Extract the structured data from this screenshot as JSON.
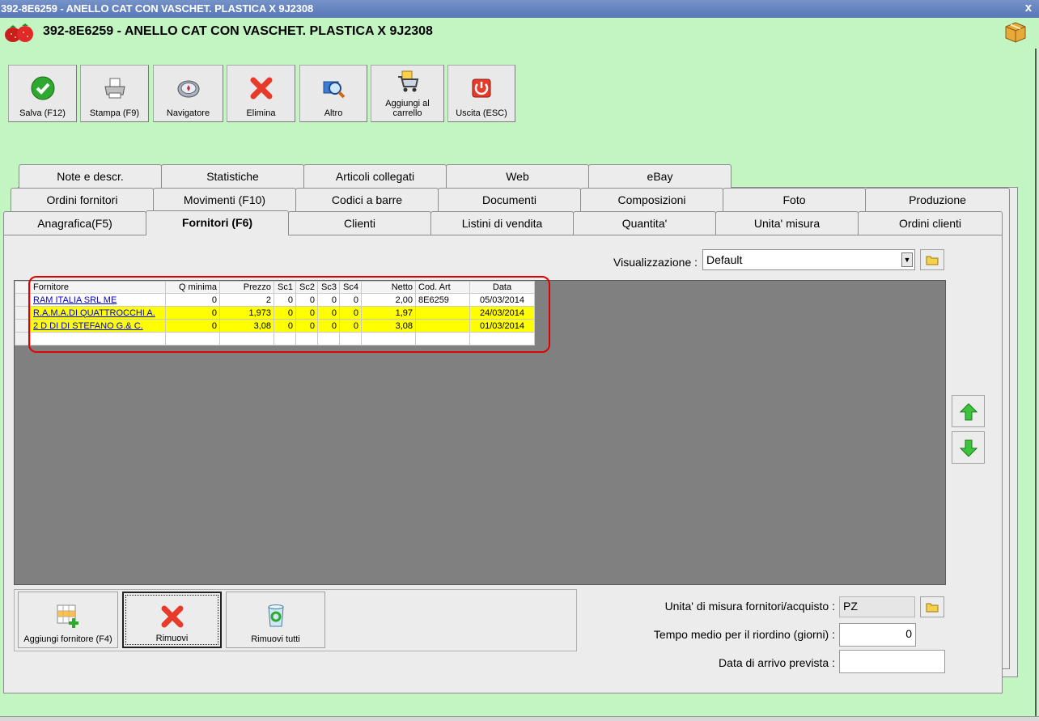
{
  "window": {
    "titlebar_text": "392-8E6259 - ANELLO CAT CON VASCHET. PLASTICA X 9J2308",
    "close_glyph": "x",
    "header_title": "392-8E6259 - ANELLO CAT CON VASCHET. PLASTICA X 9J2308",
    "accent_color": "#c2f5c2"
  },
  "toolbar": {
    "save": "Salva (F12)",
    "print": "Stampa (F9)",
    "navigator": "Navigatore",
    "delete": "Elimina",
    "other": "Altro",
    "add_to_cart_1": "Aggiungi al",
    "add_to_cart_2": "carrello",
    "exit": "Uscita (ESC)"
  },
  "tabs": {
    "row1": [
      "Note e descr.",
      "Statistiche",
      "Articoli collegati",
      "Web",
      "eBay"
    ],
    "row2": [
      "Ordini fornitori",
      "Movimenti (F10)",
      "Codici a barre",
      "Documenti",
      "Composizioni",
      "Foto",
      "Produzione"
    ],
    "row3": [
      "Anagrafica(F5)",
      "Fornitori (F6)",
      "Clienti",
      "Listini di vendita",
      "Quantita'",
      "Unita' misura",
      "Ordini clienti"
    ],
    "active": "Fornitori (F6)"
  },
  "view": {
    "label": "Visualizzazione :",
    "value": "Default"
  },
  "grid": {
    "headers": [
      "Fornitore",
      "Q minima",
      "Prezzo",
      "Sc1",
      "Sc2",
      "Sc3",
      "Sc4",
      "Netto",
      "Cod. Art",
      "Data"
    ],
    "rows": [
      {
        "fornitore": "RAM ITALIA SRL    ME",
        "qmin": "0",
        "prezzo": "2",
        "sc1": "0",
        "sc2": "0",
        "sc3": "0",
        "sc4": "0",
        "netto": "2,00",
        "codart": "8E6259",
        "data": "05/03/2014"
      },
      {
        "fornitore": "R.A.M.A.DI QUATTROCCHI A.",
        "qmin": "0",
        "prezzo": "1,973",
        "sc1": "0",
        "sc2": "0",
        "sc3": "0",
        "sc4": "0",
        "netto": "1,97",
        "codart": "",
        "data": "24/03/2014"
      },
      {
        "fornitore": "2 D DI DI STEFANO G.& C.",
        "qmin": "0",
        "prezzo": "3,08",
        "sc1": "0",
        "sc2": "0",
        "sc3": "0",
        "sc4": "0",
        "netto": "3,08",
        "codart": "",
        "data": "01/03/2014"
      }
    ],
    "highlight_color": "#ffff00"
  },
  "actions": {
    "add_supplier": "Aggiungi fornitore (F4)",
    "remove": "Rimuovi",
    "remove_all": "Rimuovi tutti"
  },
  "fields": {
    "uom_label": "Unita' di misura fornitori/acquisto :",
    "uom_value": "PZ",
    "reorder_label": "Tempo medio per il riordino (giorni) :",
    "reorder_value": "0",
    "arrival_label": "Data di arrivo prevista :",
    "arrival_value": ""
  }
}
